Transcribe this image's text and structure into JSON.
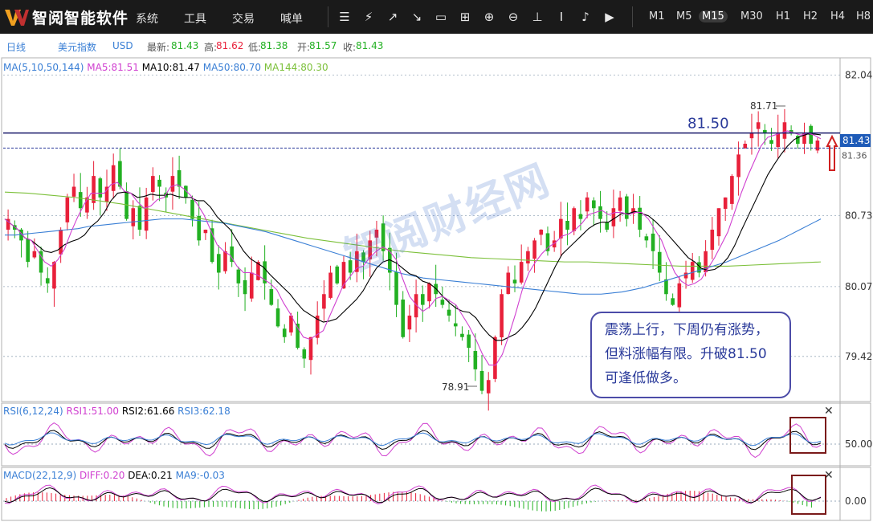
{
  "app": {
    "brand": "智阅智能软件",
    "menu": [
      "系统",
      "工具",
      "交易",
      "喊单"
    ],
    "tools": [
      "list-icon",
      "flash-icon",
      "chart-up-icon",
      "chart-down-icon",
      "window-icon",
      "grid-icon",
      "zoom-in-icon",
      "zoom-out-icon",
      "crosshair-icon",
      "text-cursor-icon",
      "sound-icon",
      "video-icon"
    ],
    "periods": [
      "M1",
      "M5",
      "M15",
      "M30",
      "H1",
      "H2",
      "H4",
      "H8"
    ],
    "active_period": "M15"
  },
  "info": {
    "period": "日线",
    "symbol": "美元指数",
    "currency": "USD",
    "latest_label": "最新:",
    "latest": "81.43",
    "high_label": "高:",
    "high": "81.62",
    "low_label": "低:",
    "low": "81.38",
    "open_label": "开:",
    "open": "81.57",
    "close_label": "收:",
    "close": "81.43"
  },
  "colors": {
    "up": "#e8203a",
    "down": "#22b022",
    "ma5": "#d040d0",
    "ma10": "#000000",
    "ma50": "#3a7fd5",
    "ma144": "#7cc03a",
    "rsi1": "#d040d0",
    "rsi2": "#000000",
    "rsi3": "#3a7fd5"
  },
  "annotation": {
    "level_label": "81.50",
    "lines": [
      "震荡上行，下周仍有涨势，",
      "但料涨幅有限。升破81.50",
      "可逢低做多。"
    ],
    "peak_label": "81.71",
    "trough_label": "78.91",
    "watermark": "智阅财经网"
  },
  "chart_data": [
    {
      "type": "candlestick",
      "title": "MA(5,10,50,144)",
      "legend": [
        {
          "name": "MA5",
          "value": "81.51"
        },
        {
          "name": "MA10",
          "value": "81.47"
        },
        {
          "name": "MA50",
          "value": "80.70"
        },
        {
          "name": "MA144",
          "value": "80.30"
        }
      ],
      "y_ticks": [
        "82.04",
        "80.73",
        "80.07",
        "79.42"
      ],
      "ylim": [
        79.0,
        82.2
      ],
      "last_price": "81.43",
      "ref_line": "81.36",
      "candle_count": 160,
      "close": [
        80.7,
        80.6,
        80.5,
        80.3,
        80.4,
        80.2,
        80.1,
        80.3,
        80.6,
        80.9,
        81.0,
        80.8,
        80.9,
        81.1,
        80.9,
        81.0,
        81.2,
        81.0,
        80.7,
        80.8,
        80.6,
        80.9,
        81.1,
        81.0,
        80.9,
        81.1,
        81.0,
        80.9,
        80.7,
        80.5,
        80.6,
        80.3,
        80.2,
        80.4,
        80.3,
        80.1,
        80.0,
        80.2,
        80.3,
        80.1,
        79.9,
        79.7,
        79.6,
        79.8,
        79.5,
        79.4,
        79.6,
        79.8,
        80.0,
        80.2,
        80.1,
        80.3,
        80.2,
        80.4,
        80.3,
        80.5,
        80.6,
        80.4,
        80.2,
        79.9,
        79.6,
        79.8,
        80.0,
        79.9,
        80.1,
        80.0,
        79.9,
        79.8,
        79.7,
        79.6,
        79.5,
        79.3,
        79.1,
        79.2,
        79.6,
        80.0,
        80.2,
        80.1,
        80.3,
        80.4,
        80.5,
        80.6,
        80.4,
        80.5,
        80.7,
        80.6,
        80.8,
        80.7,
        80.9,
        80.8,
        80.7,
        80.6,
        80.8,
        80.9,
        80.7,
        80.8,
        80.6,
        80.5,
        80.4,
        80.2,
        80.0,
        79.9,
        80.1,
        80.2,
        80.3,
        80.2,
        80.4,
        80.6,
        80.8,
        80.9,
        81.1,
        81.3,
        81.4,
        81.5,
        81.6,
        81.5,
        81.4,
        81.5,
        81.6,
        81.5,
        81.4,
        81.5,
        81.4,
        81.43
      ],
      "ma50": [
        80.55,
        80.55,
        80.56,
        80.57,
        80.58,
        80.59,
        80.6,
        80.61,
        80.63,
        80.64,
        80.65,
        80.66,
        80.67,
        80.68,
        80.69,
        80.7,
        80.7,
        80.7,
        80.69,
        80.68,
        80.67,
        80.66,
        80.64,
        80.62,
        80.6,
        80.58,
        80.55,
        80.52,
        80.49,
        80.46,
        80.43,
        80.4,
        80.37,
        80.34,
        80.31,
        80.28,
        80.25,
        80.22,
        80.19,
        80.17,
        80.15,
        80.14,
        80.13,
        80.12,
        80.11,
        80.1,
        80.09,
        80.08,
        80.07,
        80.06,
        80.05,
        80.04,
        80.03,
        80.02,
        80.01,
        80.0,
        80.0,
        80.0,
        80.01,
        80.02,
        80.04,
        80.06,
        80.09,
        80.12,
        80.15,
        80.18,
        80.21,
        80.24,
        80.27,
        80.3,
        80.34,
        80.38,
        80.42,
        80.46,
        80.5,
        80.55,
        80.6,
        80.65,
        80.7
      ],
      "ma144": [
        80.95,
        80.94,
        80.92,
        80.9,
        80.87,
        80.84,
        80.8,
        80.76,
        80.72,
        80.68,
        80.64,
        80.6,
        80.56,
        80.52,
        80.49,
        80.46,
        80.43,
        80.4,
        80.38,
        80.36,
        80.34,
        80.33,
        80.32,
        80.31,
        80.3,
        80.3,
        80.29,
        80.28,
        80.27,
        80.26,
        80.26,
        80.26,
        80.27,
        80.28,
        80.29,
        80.3
      ]
    },
    {
      "type": "line",
      "title": "RSI(6,12,24)",
      "legend": [
        {
          "name": "RSI1",
          "value": "51.00"
        },
        {
          "name": "RSI2",
          "value": "61.66"
        },
        {
          "name": "RSI3",
          "value": "62.18"
        }
      ],
      "y_ticks": [
        "50.00"
      ]
    },
    {
      "type": "bar",
      "title": "MACD(22,12,9)",
      "legend": [
        {
          "name": "DIFF",
          "value": "0.20"
        },
        {
          "name": "DEA",
          "value": "0.21"
        },
        {
          "name": "MA9",
          "value": "-0.03"
        }
      ],
      "y_ticks": [
        "0.00"
      ]
    }
  ]
}
